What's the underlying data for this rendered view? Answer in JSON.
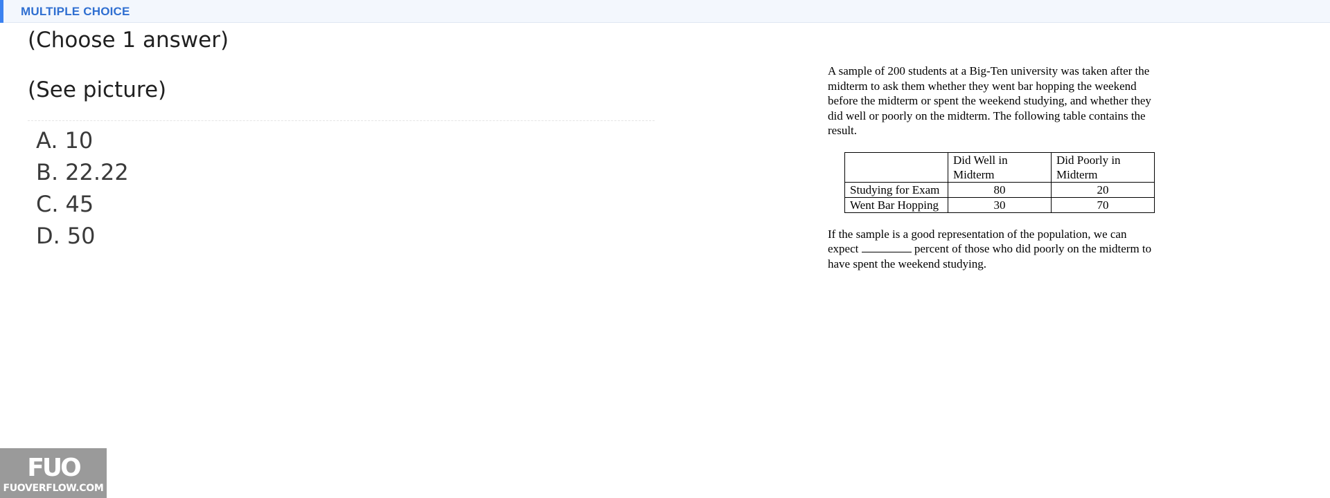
{
  "header": {
    "label": "MULTIPLE CHOICE",
    "accent_color": "#3c82f0",
    "label_color": "#2f6fd1"
  },
  "question": {
    "prompt": "(Choose 1 answer)",
    "prompt2": "(See picture)"
  },
  "options": [
    {
      "letter": "A.",
      "text": "10"
    },
    {
      "letter": "B.",
      "text": "22.22"
    },
    {
      "letter": "C.",
      "text": "45"
    },
    {
      "letter": "D.",
      "text": "50"
    }
  ],
  "picture": {
    "intro": "A sample of 200 students at a Big-Ten university was taken after the midterm to ask them whether they went bar hopping the weekend before the midterm or spent the weekend studying, and whether they did well or poorly on the midterm. The following table contains the result.",
    "table": {
      "headers": [
        "",
        "Did Well in Midterm",
        "Did Poorly in Midterm"
      ],
      "rows": [
        {
          "label": "Studying for Exam",
          "values": [
            "80",
            "20"
          ]
        },
        {
          "label": "Went Bar Hopping",
          "values": [
            "30",
            "70"
          ]
        }
      ]
    },
    "question_before": "If the sample is a good representation of the population, we can expect",
    "question_after": "percent of those who did poorly on the midterm to have spent the weekend studying."
  },
  "watermark": {
    "logo": "FUO",
    "text": "FUOVERFLOW.COM"
  }
}
